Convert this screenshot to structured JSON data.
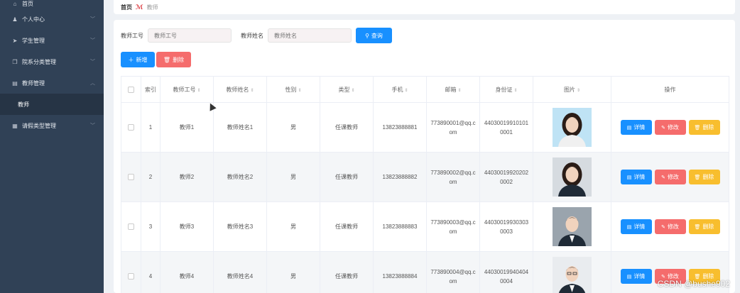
{
  "sidebar": {
    "items": [
      {
        "label": "首页",
        "icon": "home-icon",
        "glyph": "⌂",
        "has_chevron": false
      },
      {
        "label": "个人中心",
        "icon": "user-icon",
        "glyph": "♟",
        "has_chevron": true
      },
      {
        "label": "学生管理",
        "icon": "send-icon",
        "glyph": "➤",
        "has_chevron": true
      },
      {
        "label": "院系分类管理",
        "icon": "copy-icon",
        "glyph": "❐",
        "has_chevron": true
      },
      {
        "label": "教师管理",
        "icon": "bank-icon",
        "glyph": "▤",
        "has_chevron": true,
        "expanded": true
      },
      {
        "label": "教师",
        "icon": "",
        "glyph": "",
        "has_chevron": false,
        "sub": true
      },
      {
        "label": "请假类型管理",
        "icon": "grid-icon",
        "glyph": "▦",
        "has_chevron": true
      }
    ]
  },
  "breadcrumb": {
    "home": "首页",
    "current": "教师"
  },
  "search": {
    "id_label": "教师工号",
    "id_placeholder": "教师工号",
    "name_label": "教师姓名",
    "name_placeholder": "教师姓名",
    "query_label": "查询"
  },
  "actions": {
    "add_label": "新增",
    "delete_label": "删除"
  },
  "table": {
    "headers": [
      "索引",
      "教师工号",
      "教师姓名",
      "性别",
      "类型",
      "手机",
      "邮箱",
      "身份证",
      "图片",
      "操作"
    ],
    "row_buttons": {
      "detail": "详情",
      "edit": "修改",
      "remove": "删除"
    },
    "rows": [
      {
        "index": "1",
        "teacher_id": "教师1",
        "teacher_name": "教师姓名1",
        "gender": "男",
        "type": "任课教师",
        "phone": "13823888881",
        "email": "773890001@qq.com",
        "id_card": "440300199101010001",
        "photo": "female-portrait"
      },
      {
        "index": "2",
        "teacher_id": "教师2",
        "teacher_name": "教师姓名2",
        "gender": "男",
        "type": "任课教师",
        "phone": "13823888882",
        "email": "773890002@qq.com",
        "id_card": "440300199202020002",
        "photo": "female-portrait-dark"
      },
      {
        "index": "3",
        "teacher_id": "教师3",
        "teacher_name": "教师姓名3",
        "gender": "男",
        "type": "任课教师",
        "phone": "13823888883",
        "email": "773890003@qq.com",
        "id_card": "440300199303030003",
        "photo": "male-portrait-suit"
      },
      {
        "index": "4",
        "teacher_id": "教师4",
        "teacher_name": "教师姓名4",
        "gender": "男",
        "type": "任课教师",
        "phone": "13823888884",
        "email": "773890004@qq.com",
        "id_card": "440300199404040004",
        "photo": "male-portrait-glasses"
      }
    ]
  },
  "watermark": "CSDN @bushe902",
  "colors": {
    "primary": "#1890ff",
    "danger": "#f56c6c",
    "warning": "#f8be2e",
    "sidebar": "#304156"
  }
}
